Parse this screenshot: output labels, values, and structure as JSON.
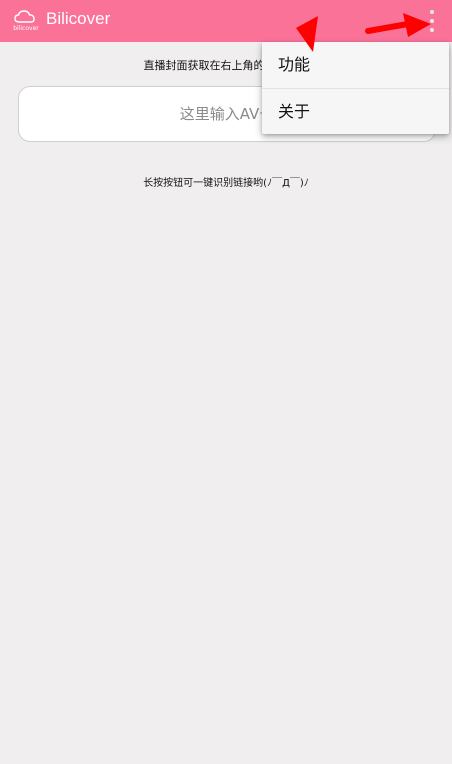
{
  "toolbar": {
    "title": "Bilicover",
    "logo_text": "bilicover",
    "logo_icon": "cloud-logo-icon",
    "overflow_icon": "more-vert-icon",
    "background_color": "#fb7299"
  },
  "main": {
    "hint_top": "直播封面获取在右上角的功能菜单",
    "input_placeholder": "这里输入AV号",
    "input_value": "",
    "hint_bottom": "长按按钮可一键识别链接哟(ﾉ￣Д￣)ﾉ"
  },
  "menu": {
    "items": [
      {
        "label": "功能"
      },
      {
        "label": "关于"
      }
    ]
  },
  "annotations": {
    "arrow_color": "#ff0000"
  }
}
